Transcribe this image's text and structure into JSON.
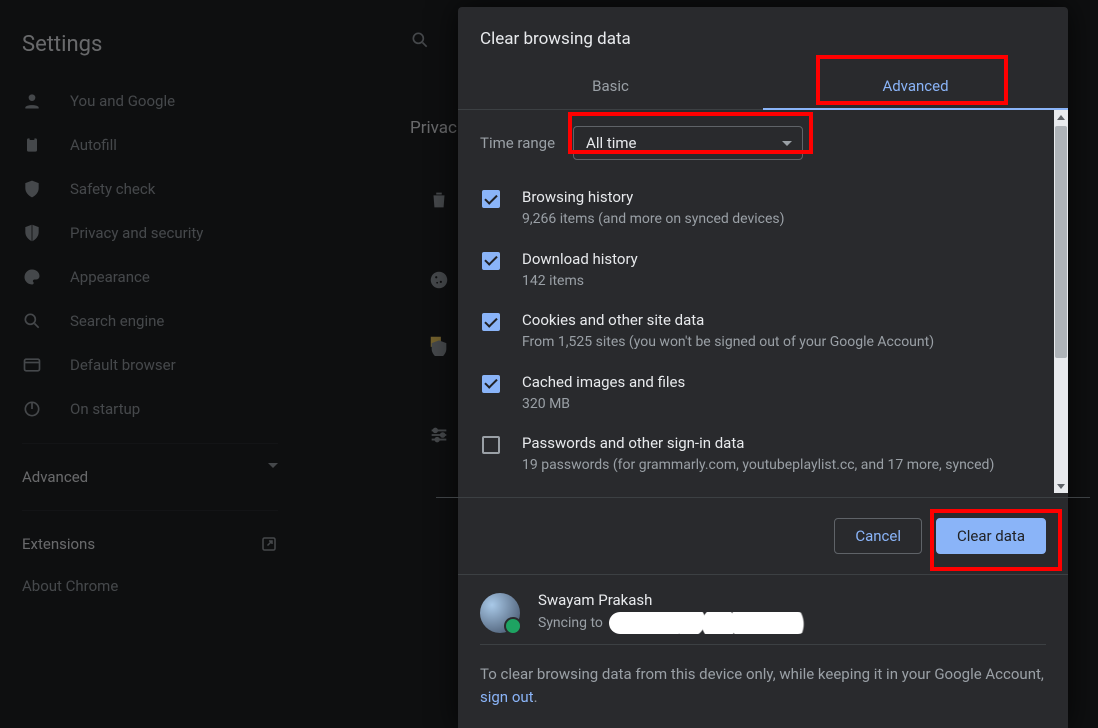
{
  "sidebar": {
    "title": "Settings",
    "items": [
      {
        "label": "You and Google"
      },
      {
        "label": "Autofill"
      },
      {
        "label": "Safety check"
      },
      {
        "label": "Privacy and security"
      },
      {
        "label": "Appearance"
      },
      {
        "label": "Search engine"
      },
      {
        "label": "Default browser"
      },
      {
        "label": "On startup"
      }
    ],
    "advanced_label": "Advanced",
    "extensions_label": "Extensions",
    "about_label": "About Chrome"
  },
  "background_page_title": "Privac",
  "dialog": {
    "title": "Clear browsing data",
    "tabs": {
      "basic": "Basic",
      "advanced": "Advanced"
    },
    "time_label": "Time range",
    "time_value": "All time",
    "items": [
      {
        "checked": true,
        "title": "Browsing history",
        "sub": "9,266 items (and more on synced devices)"
      },
      {
        "checked": true,
        "title": "Download history",
        "sub": "142 items"
      },
      {
        "checked": true,
        "title": "Cookies and other site data",
        "sub": "From 1,525 sites (you won't be signed out of your Google Account)"
      },
      {
        "checked": true,
        "title": "Cached images and files",
        "sub": "320 MB"
      },
      {
        "checked": false,
        "title": "Passwords and other sign-in data",
        "sub": "19 passwords (for grammarly.com, youtubeplaylist.cc, and 17 more, synced)"
      }
    ],
    "cancel_label": "Cancel",
    "clear_label": "Clear data",
    "user_name": "Swayam Prakash",
    "sync_prefix": "Syncing to",
    "footer_text_1": "To clear browsing data from this device only, while keeping it in your Google Account, ",
    "signout_label": "sign out",
    "footer_text_2": "."
  }
}
